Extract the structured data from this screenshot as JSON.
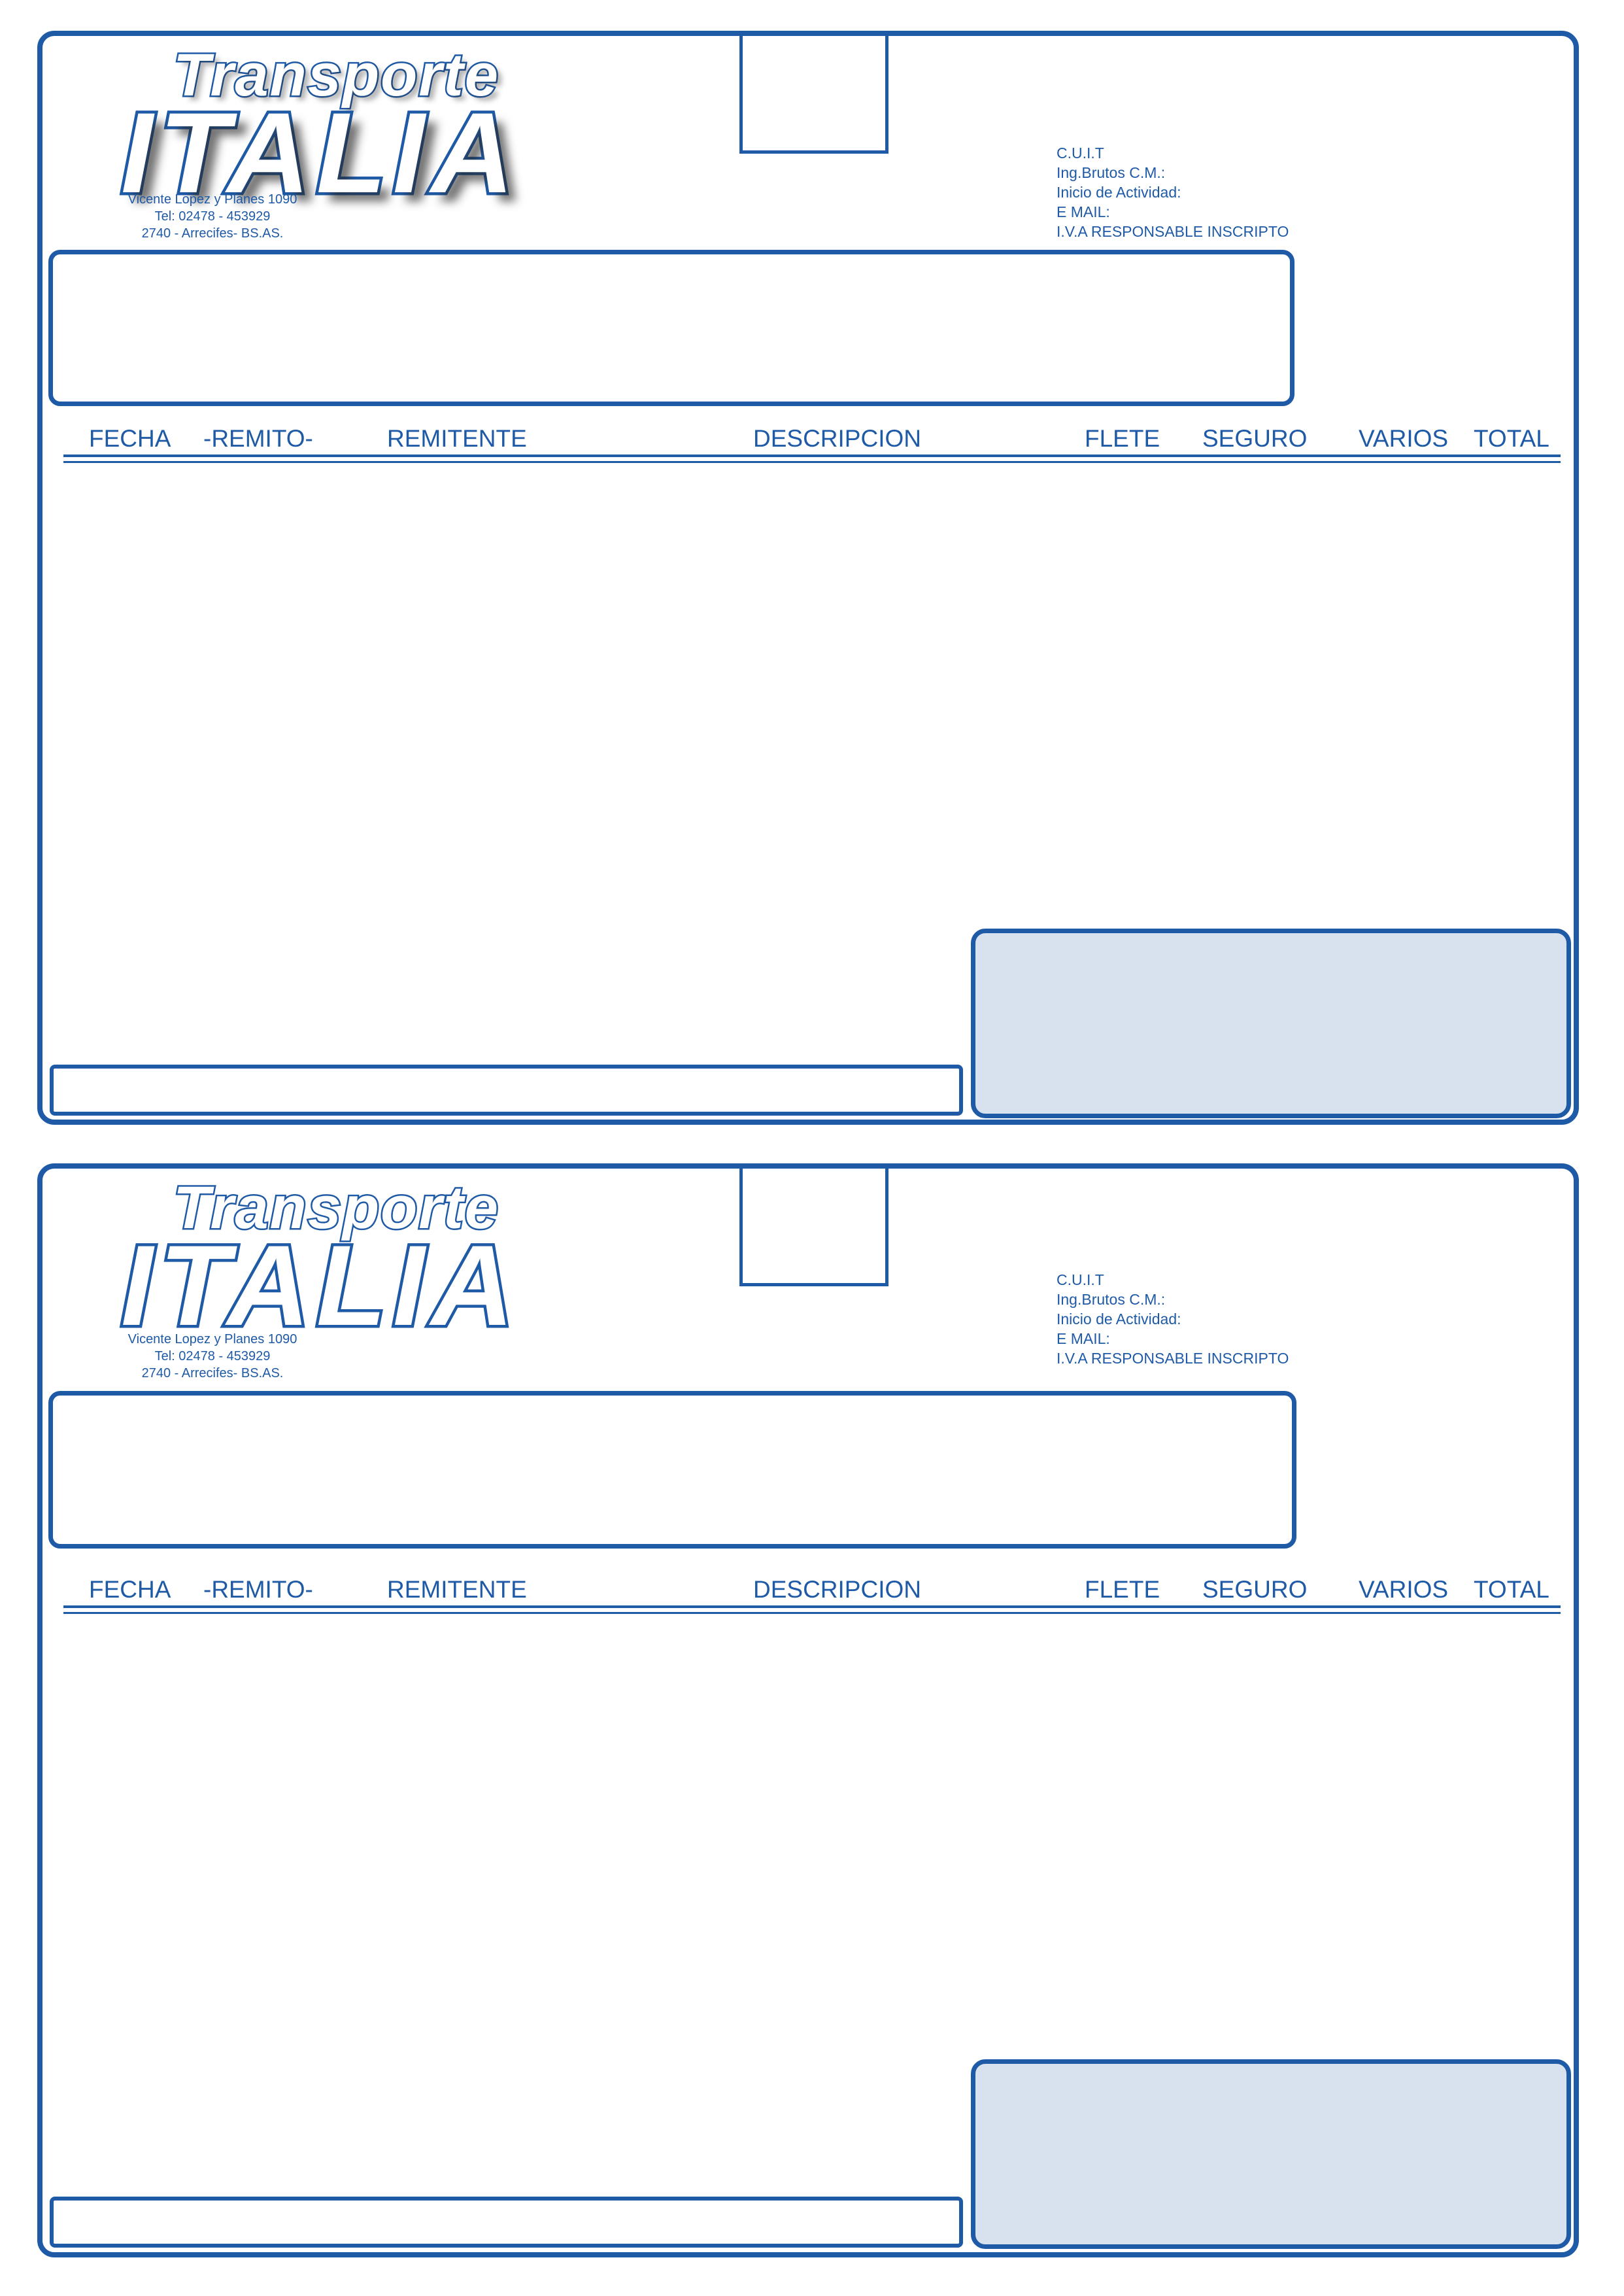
{
  "forms": [
    {
      "logo": {
        "line1": "Transporte",
        "line2": "ITALIA"
      },
      "address": [
        "Vicente Lopez y Planes 1090",
        "Tel: 02478 - 453929",
        "2740 - Arrecifes- BS.AS."
      ],
      "fiscal": [
        "C.U.I.T",
        "Ing.Brutos C.M.:",
        "Inicio de Actividad:",
        "E MAIL:",
        "I.V.A RESPONSABLE INSCRIPTO"
      ],
      "columns": {
        "fecha": "FECHA",
        "remito": "-REMITO-",
        "remitente": "REMITENTE",
        "descripcion": "DESCRIPCION",
        "flete": "FLETE",
        "seguro": "SEGURO",
        "varios": "VARIOS",
        "total": "TOTAL"
      }
    },
    {
      "logo": {
        "line1": "Transporte",
        "line2": "ITALIA"
      },
      "address": [
        "Vicente Lopez y Planes 1090",
        "Tel: 02478 - 453929",
        "2740 - Arrecifes- BS.AS."
      ],
      "fiscal": [
        "C.U.I.T",
        "Ing.Brutos C.M.:",
        "Inicio de Actividad:",
        "E MAIL:",
        "I.V.A RESPONSABLE INSCRIPTO"
      ],
      "columns": {
        "fecha": "FECHA",
        "remito": "-REMITO-",
        "remitente": "REMITENTE",
        "descripcion": "DESCRIPCION",
        "flete": "FLETE",
        "seguro": "SEGURO",
        "varios": "VARIOS",
        "total": "TOTAL"
      }
    }
  ],
  "colors": {
    "brand_blue": "#1f5aa6",
    "totals_fill": "#d8e2ef"
  }
}
